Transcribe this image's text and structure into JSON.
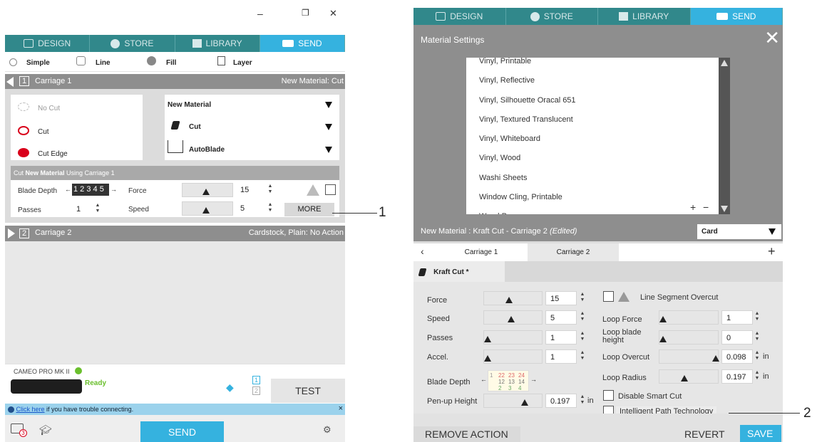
{
  "window_controls": {
    "minimize": "–",
    "restore": "❐",
    "close": "✕"
  },
  "left": {
    "tabs": [
      {
        "label": "DESIGN",
        "icon": "grid-icon"
      },
      {
        "label": "STORE",
        "icon": "store-icon"
      },
      {
        "label": "LIBRARY",
        "icon": "library-icon"
      },
      {
        "label": "SEND",
        "icon": "cutter-icon"
      }
    ],
    "modes": {
      "simple": "Simple",
      "line": "Line",
      "fill": "Fill",
      "layer": "Layer"
    },
    "carriage1": {
      "number": "1",
      "title": "Carriage 1",
      "status": "New Material: Cut"
    },
    "actions": {
      "no_cut": "No Cut",
      "cut": "Cut",
      "cut_edge": "Cut Edge"
    },
    "material": {
      "name": "New Material",
      "action": "Cut",
      "tool": "AutoBlade"
    },
    "cut_using": {
      "prefix": "Cut ",
      "material": "New Material",
      "suffix": " Using Carriage 1"
    },
    "settings": {
      "blade_depth_label": "Blade Depth",
      "blade_digits": "1 2 3 4 5",
      "force_label": "Force",
      "force_value": "15",
      "passes_label": "Passes",
      "passes_value": "1",
      "speed_label": "Speed",
      "speed_value": "5",
      "more_label": "MORE"
    },
    "carriage2": {
      "number": "2",
      "title": "Carriage 2",
      "status": "Cardstock, Plain: No Action"
    },
    "device": {
      "name": "CAMEO PRO MK II",
      "status": "Ready",
      "test_label": "TEST",
      "indicator_1": "1",
      "indicator_2": "2"
    },
    "notice": {
      "link": "Click here",
      "text": " if you have trouble connecting.",
      "close": "×"
    },
    "send_label": "SEND",
    "bottom_badge": "3"
  },
  "right": {
    "tabs": [
      {
        "label": "DESIGN"
      },
      {
        "label": "STORE"
      },
      {
        "label": "LIBRARY"
      },
      {
        "label": "SEND"
      }
    ],
    "panel_title": "Material Settings",
    "materials": [
      "Vinyl, Printable",
      "Vinyl, Reflective",
      "Vinyl, Silhouette Oracal 651",
      "Vinyl, Textured Translucent",
      "Vinyl, Whiteboard",
      "Vinyl, Wood",
      "Washi Sheets",
      "Window Cling, Printable",
      "Wood Paper"
    ],
    "list_add": "+",
    "list_remove": "−",
    "material_header": {
      "title": "New Material : Kraft Cut - Carriage 2 ",
      "edited": "(Edited)",
      "select_value": "Card"
    },
    "carriage_tabs": {
      "c1": "Carriage 1",
      "c2": "Carriage 2",
      "add": "+"
    },
    "action_tab": "Kraft Cut *",
    "params": {
      "force": {
        "label": "Force",
        "value": "15"
      },
      "speed": {
        "label": "Speed",
        "value": "5"
      },
      "passes": {
        "label": "Passes",
        "value": "1"
      },
      "accel": {
        "label": "Accel.",
        "value": "1"
      },
      "blade_depth": {
        "label": "Blade Depth"
      },
      "penup": {
        "label": "Pen-up Height",
        "value": "0.197",
        "unit": "in"
      }
    },
    "blade_grid": [
      "1",
      "22",
      "23",
      "24",
      "12",
      "13",
      "14",
      "2",
      "3",
      "4"
    ],
    "overcut": {
      "line_segment": "Line Segment Overcut",
      "loop_force": {
        "label": "Loop Force",
        "value": "1"
      },
      "loop_blade_height": {
        "label": "Loop blade height",
        "value": "0"
      },
      "loop_overcut": {
        "label": "Loop Overcut",
        "value": "0.098",
        "unit": "in"
      },
      "loop_radius": {
        "label": "Loop Radius",
        "value": "0.197",
        "unit": "in"
      },
      "disable_smart_cut": "Disable Smart Cut",
      "intelligent_path": "Intelligent Path Technology"
    },
    "footer": {
      "remove": "REMOVE ACTION",
      "revert": "REVERT",
      "save": "SAVE"
    }
  },
  "callouts": {
    "c1": "1",
    "c2": "2"
  },
  "colors": {
    "teal": "#2e8f92",
    "send_blue": "#35b2df",
    "panel_grey": "#8e8e8e"
  }
}
